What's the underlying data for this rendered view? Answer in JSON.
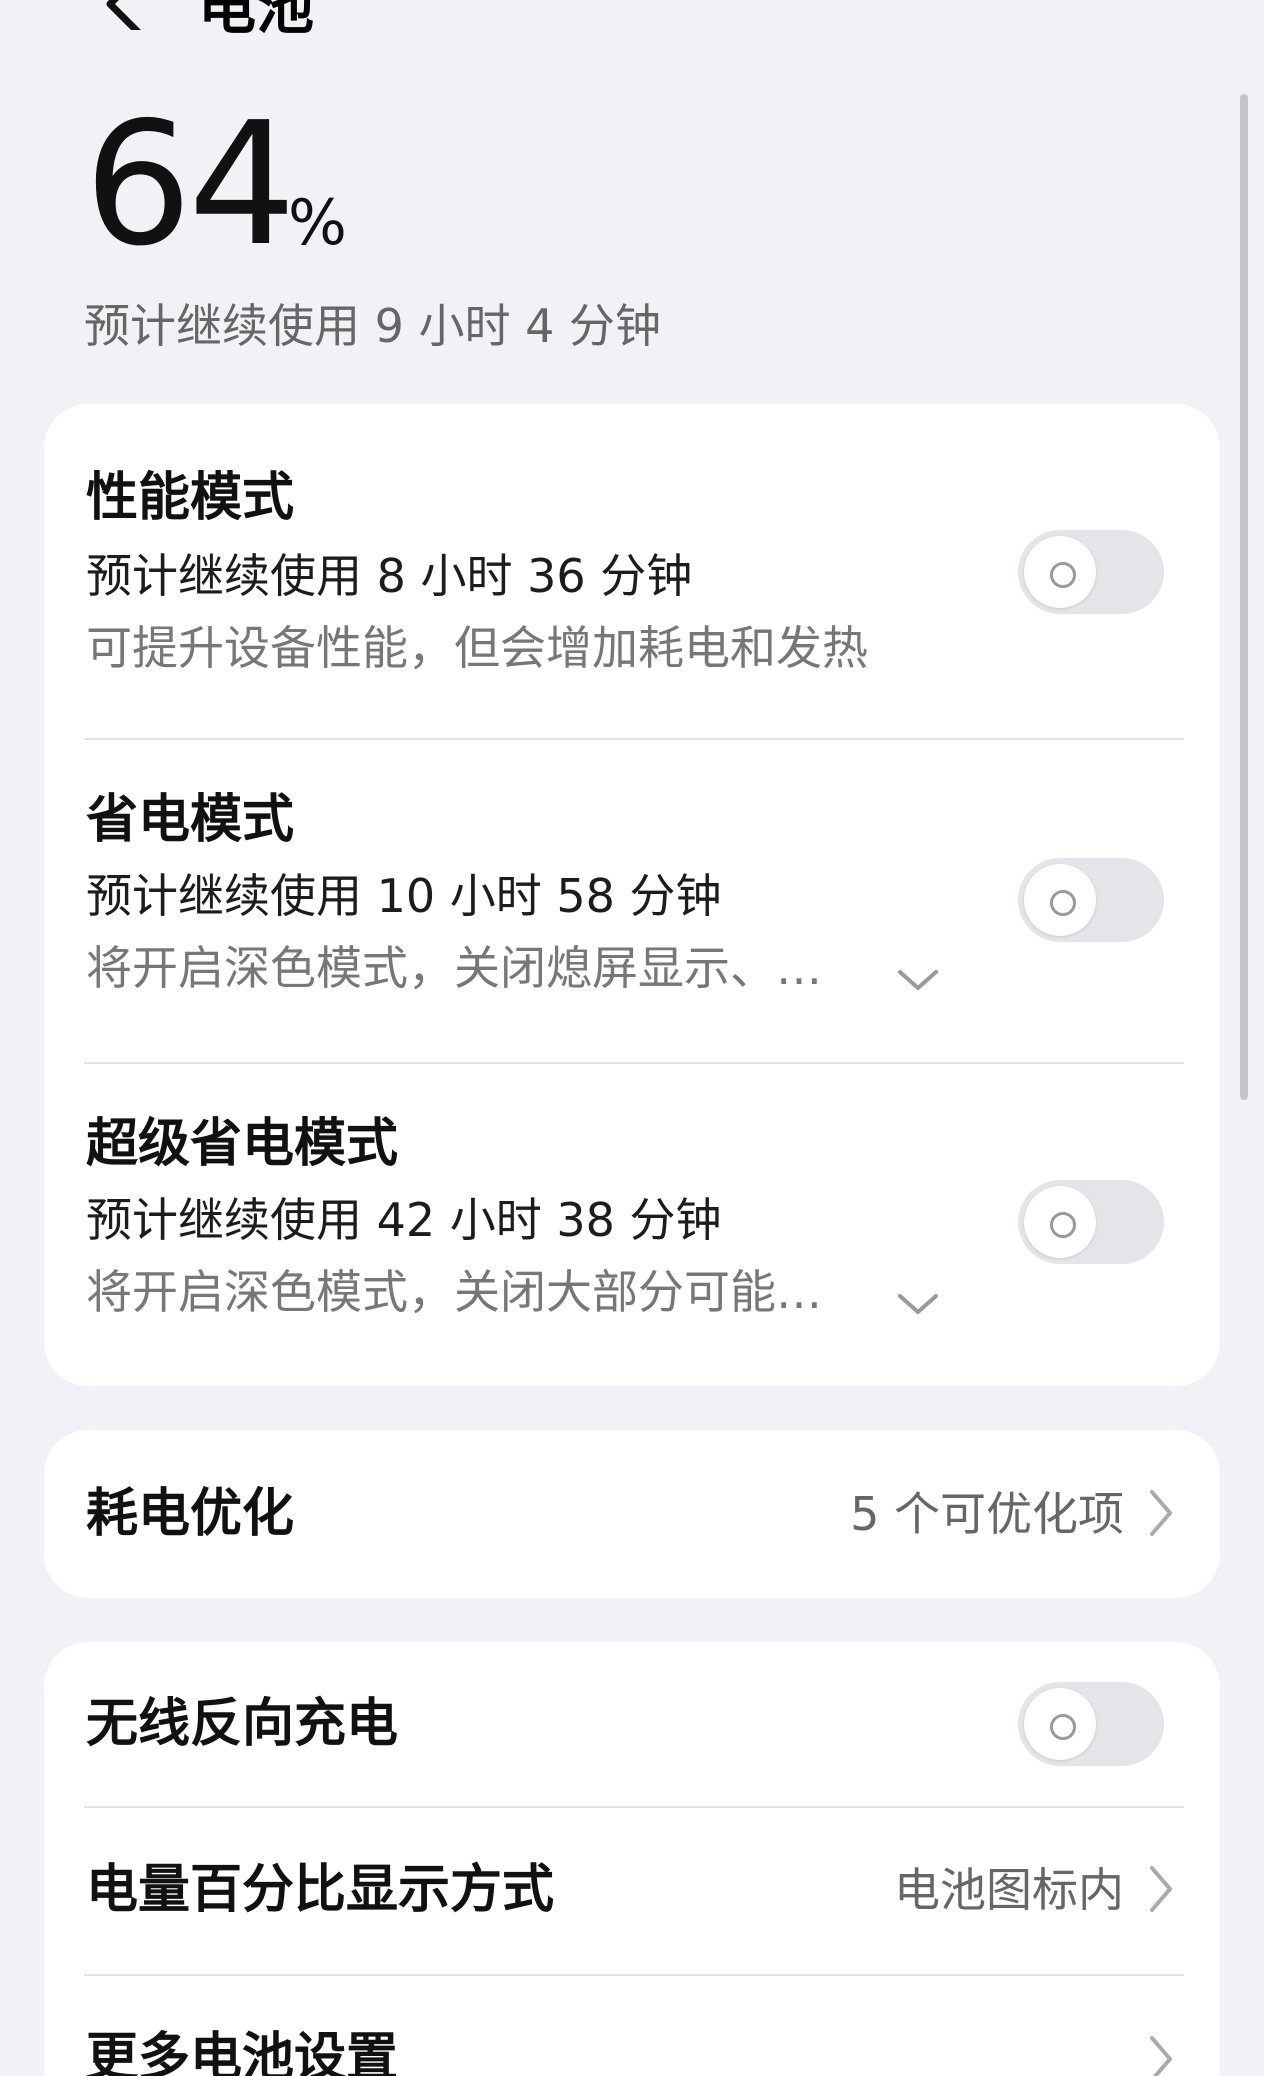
{
  "header": {
    "title": "电池"
  },
  "battery": {
    "percent": "64",
    "percent_sign": "%",
    "estimate": "预计继续使用 9 小时 4 分钟"
  },
  "modes": [
    {
      "title": "性能模式",
      "estimate": "预计继续使用 8 小时 36 分钟",
      "desc": "可提升设备性能，但会增加耗电和发热",
      "enabled": false
    },
    {
      "title": "省电模式",
      "estimate": "预计继续使用 10 小时 58 分钟",
      "desc": "将开启深色模式，关闭熄屏显示、…",
      "enabled": false
    },
    {
      "title": "超级省电模式",
      "estimate": "预计继续使用 42 小时 38 分钟",
      "desc": "将开启深色模式，关闭大部分可能…",
      "enabled": false
    }
  ],
  "optimize": {
    "title": "耗电优化",
    "value": "5 个可优化项"
  },
  "settings": {
    "wireless_reverse": {
      "title": "无线反向充电",
      "enabled": false
    },
    "percent_display": {
      "title": "电量百分比显示方式",
      "value": "电池图标内"
    },
    "more": {
      "title": "更多电池设置"
    }
  }
}
